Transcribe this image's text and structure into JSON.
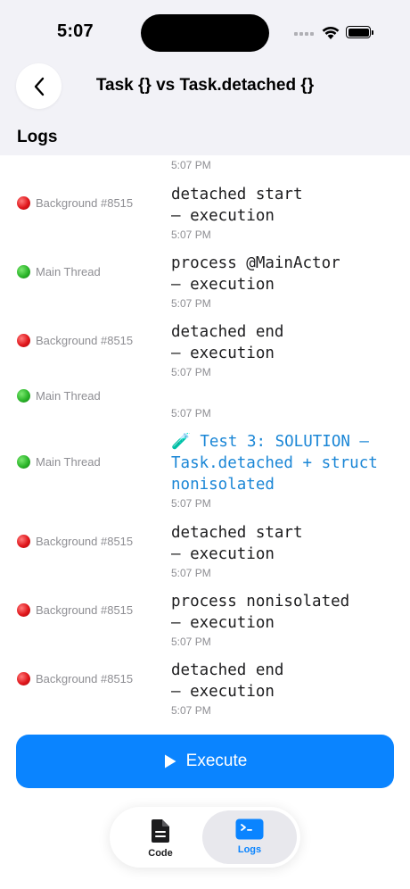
{
  "status_bar": {
    "time": "5:07"
  },
  "nav": {
    "title": "Task {} vs Task.detached {}"
  },
  "section": {
    "title": "Logs"
  },
  "partial_timestamp": "5:07 PM",
  "logs": [
    {
      "thread": "Background #8515",
      "thread_color": "red",
      "message": "detached start\n— execution",
      "time": "5:07 PM",
      "accent": false
    },
    {
      "thread": "Main Thread",
      "thread_color": "green",
      "message": "process @MainActor\n— execution",
      "time": "5:07 PM",
      "accent": false
    },
    {
      "thread": "Background #8515",
      "thread_color": "red",
      "message": "detached end\n— execution",
      "time": "5:07 PM",
      "accent": false
    },
    {
      "thread": "Main Thread",
      "thread_color": "green",
      "message": "",
      "time": "5:07 PM",
      "accent": false
    },
    {
      "thread": "Main Thread",
      "thread_color": "green",
      "message": "🧪 Test 3: SOLUTION — Task.detached + struct nonisolated",
      "time": "5:07 PM",
      "accent": true
    },
    {
      "thread": "Background #8515",
      "thread_color": "red",
      "message": "detached start\n— execution",
      "time": "5:07 PM",
      "accent": false
    },
    {
      "thread": "Background #8515",
      "thread_color": "red",
      "message": "process nonisolated\n— execution",
      "time": "5:07 PM",
      "accent": false
    },
    {
      "thread": "Background #8515",
      "thread_color": "red",
      "message": "detached end\n— execution",
      "time": "5:07 PM",
      "accent": false
    }
  ],
  "execute_button": {
    "label": "Execute"
  },
  "tabs": [
    {
      "label": "Code",
      "icon": "document-icon",
      "selected": false
    },
    {
      "label": "Logs",
      "icon": "terminal-icon",
      "selected": true
    }
  ],
  "colors": {
    "accent": "#0a84ff",
    "log_accent": "#1a86d6",
    "red_dot": "#e0161b",
    "green_dot": "#2bb52a"
  }
}
